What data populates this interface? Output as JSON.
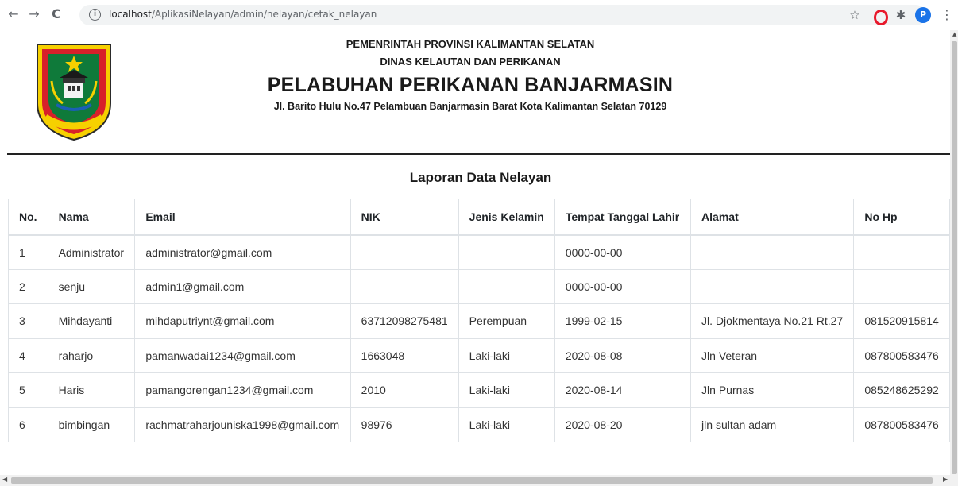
{
  "browser": {
    "url_host": "localhost",
    "url_path": "/AplikasiNelayan/admin/nelayan/cetak_nelayan",
    "avatar_letter": "P",
    "icons": [
      "back-arrow-icon",
      "forward-arrow-icon",
      "reload-icon",
      "info-icon",
      "star-icon",
      "opera-icon",
      "puzzle-icon",
      "kebab-menu-icon"
    ]
  },
  "letterhead": {
    "line1": "PEMENRINTAH PROVINSI KALIMANTAN SELATAN",
    "line2": "DINAS KELAUTAN DAN PERIKANAN",
    "line3": "PELABUHAN PERIKANAN BANJARMASIN",
    "line4": "Jl. Barito Hulu No.47 Pelambuan Banjarmasin Barat Kota Kalimantan Selatan 70129",
    "logo_motto": "WAJA SAMPAI KAPUTING"
  },
  "report": {
    "title": "Laporan Data Nelayan",
    "columns": [
      "No.",
      "Nama",
      "Email",
      "NIK",
      "Jenis Kelamin",
      "Tempat Tanggal Lahir",
      "Alamat",
      "No Hp"
    ],
    "rows": [
      [
        "1",
        "Administrator",
        "administrator@gmail.com",
        "",
        "",
        "0000-00-00",
        "",
        ""
      ],
      [
        "2",
        "senju",
        "admin1@gmail.com",
        "",
        "",
        "0000-00-00",
        "",
        ""
      ],
      [
        "3",
        "Mihdayanti",
        "mihdaputriynt@gmail.com",
        "63712098275481",
        "Perempuan",
        "1999-02-15",
        "Jl. Djokmentaya No.21 Rt.27",
        "081520915814"
      ],
      [
        "4",
        "raharjo",
        "pamanwadai1234@gmail.com",
        "1663048",
        "Laki-laki",
        "2020-08-08",
        "Jln Veteran",
        "087800583476"
      ],
      [
        "5",
        "Haris",
        "pamangorengan1234@gmail.com",
        "2010",
        "Laki-laki",
        "2020-08-14",
        "Jln Purnas",
        "085248625292"
      ],
      [
        "6",
        "bimbingan",
        "rachmatraharjouniska1998@gmail.com",
        "98976",
        "Laki-laki",
        "2020-08-20",
        "jln sultan adam",
        "087800583476"
      ]
    ]
  },
  "colors": {
    "rule": "#222222",
    "table_border": "#dee2e6",
    "logo_red": "#d7202a",
    "logo_yellow": "#f6d000",
    "logo_green": "#0f7a3a"
  }
}
